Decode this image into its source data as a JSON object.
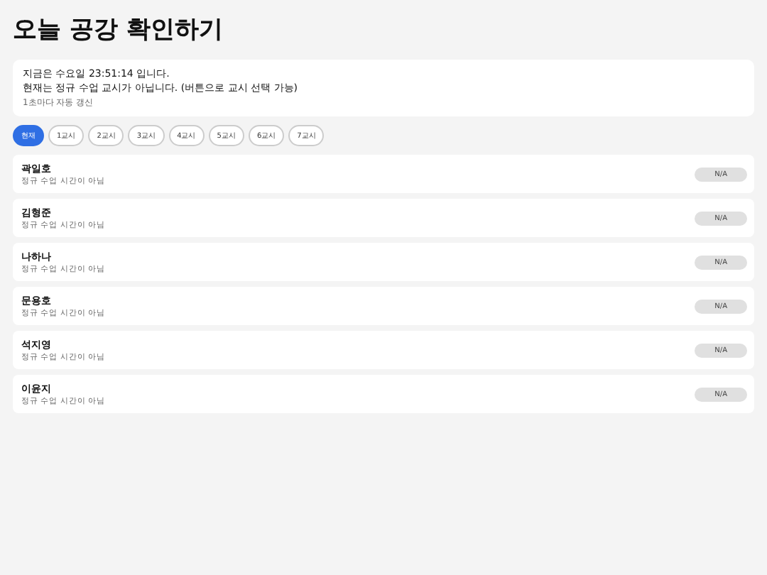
{
  "title": "오늘 공강 확인하기",
  "info": {
    "lines": [
      "지금은 수요일 23:51:14 입니다.",
      "현재는 정규 수업 교시가 아닙니다. (버튼으로 교시 선택 가능)"
    ],
    "note": "1초마다 자동 갱신"
  },
  "periods": [
    {
      "label": "현재",
      "selected": true
    },
    {
      "label": "1교시",
      "selected": false
    },
    {
      "label": "2교시",
      "selected": false
    },
    {
      "label": "3교시",
      "selected": false
    },
    {
      "label": "4교시",
      "selected": false
    },
    {
      "label": "5교시",
      "selected": false
    },
    {
      "label": "6교시",
      "selected": false
    },
    {
      "label": "7교시",
      "selected": false
    }
  ],
  "people": [
    {
      "name": "곽일호",
      "status": "정규 수업 시간이 아님",
      "badge": "N/A"
    },
    {
      "name": "김형준",
      "status": "정규 수업 시간이 아님",
      "badge": "N/A"
    },
    {
      "name": "나하나",
      "status": "정규 수업 시간이 아님",
      "badge": "N/A"
    },
    {
      "name": "문용호",
      "status": "정규 수업 시간이 아님",
      "badge": "N/A"
    },
    {
      "name": "석지영",
      "status": "정규 수업 시간이 아님",
      "badge": "N/A"
    },
    {
      "name": "이윤지",
      "status": "정규 수업 시간이 아님",
      "badge": "N/A"
    }
  ]
}
